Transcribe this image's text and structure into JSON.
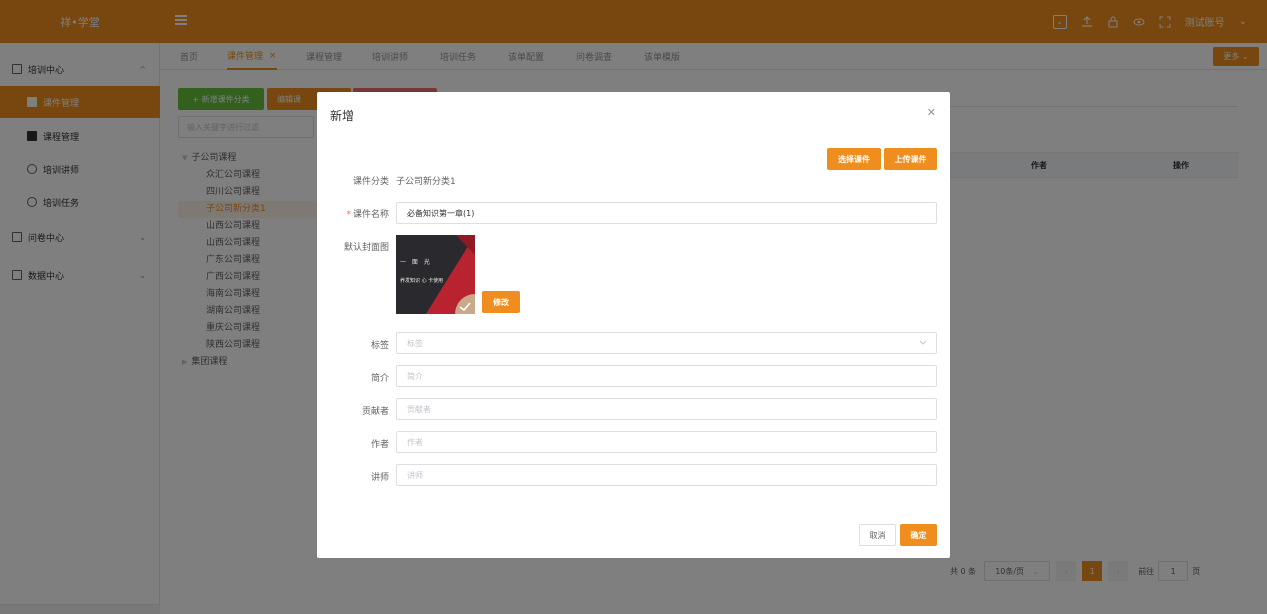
{
  "app": {
    "logo": "祥•学堂",
    "account": "测试账号"
  },
  "colors": {
    "brand": "#ef8e1f",
    "green": "#67c23a",
    "red": "#f56c6c"
  },
  "sidebar": {
    "groups": [
      {
        "label": "培训中心",
        "icon": "document-icon"
      },
      {
        "label": "问卷中心",
        "icon": "questionnaire-icon"
      },
      {
        "label": "数据中心",
        "icon": "chart-icon"
      }
    ],
    "items": [
      {
        "label": "课件管理",
        "icon": "file-icon"
      },
      {
        "label": "课程管理",
        "icon": "folder-icon"
      },
      {
        "label": "培训讲师",
        "icon": "user-icon"
      },
      {
        "label": "培训任务",
        "icon": "clock-icon"
      }
    ]
  },
  "tabs": [
    "首页",
    "课件管理",
    "课程管理",
    "培训讲师",
    "培训任务",
    "该单配置",
    "问卷调查",
    "该单模版"
  ],
  "more_label": "更多",
  "main": {
    "add_category": "+ 新增课件分类",
    "edit_category": "编辑课",
    "filter_placeholder": "输入关键字进行过滤",
    "tree": {
      "root1": "子公司课程",
      "children": [
        "众汇公司课程",
        "四川公司课程",
        "子公司新分类1",
        "山西公司课程",
        "山西公司课程",
        "广东公司课程",
        "广西公司课程",
        "海南公司课程",
        "湖南公司课程",
        "重庆公司课程",
        "陕西公司课程"
      ],
      "root2": "集团课程"
    },
    "table": {
      "col_author": "作者",
      "col_action": "操作"
    },
    "pager": {
      "total": "共 0 条",
      "page_size": "10条/页",
      "current": "1",
      "goto": "前往",
      "goto_value": "1",
      "page_unit": "页"
    }
  },
  "modal": {
    "title": "新增",
    "select_btn": "选择课件",
    "upload_btn": "上传课件",
    "category_label": "课件分类",
    "category_value": "子公司新分类1",
    "name_label": "课件名称",
    "name_value": "必备知识第一章(1)",
    "cover_label": "默认封面图",
    "cover_text1": "一 面 光",
    "cover_text2": "养发知识   心 卡使用",
    "edit_btn": "修改",
    "tag_label": "标签",
    "tag_placeholder": "标签",
    "intro_label": "简介",
    "intro_placeholder": "简介",
    "contributor_label": "贡献者",
    "contributor_placeholder": "贡献者",
    "author_label": "作者",
    "author_placeholder": "作者",
    "lecturer_label": "讲师",
    "lecturer_placeholder": "讲师",
    "cancel_btn": "取消",
    "confirm_btn": "确定"
  }
}
